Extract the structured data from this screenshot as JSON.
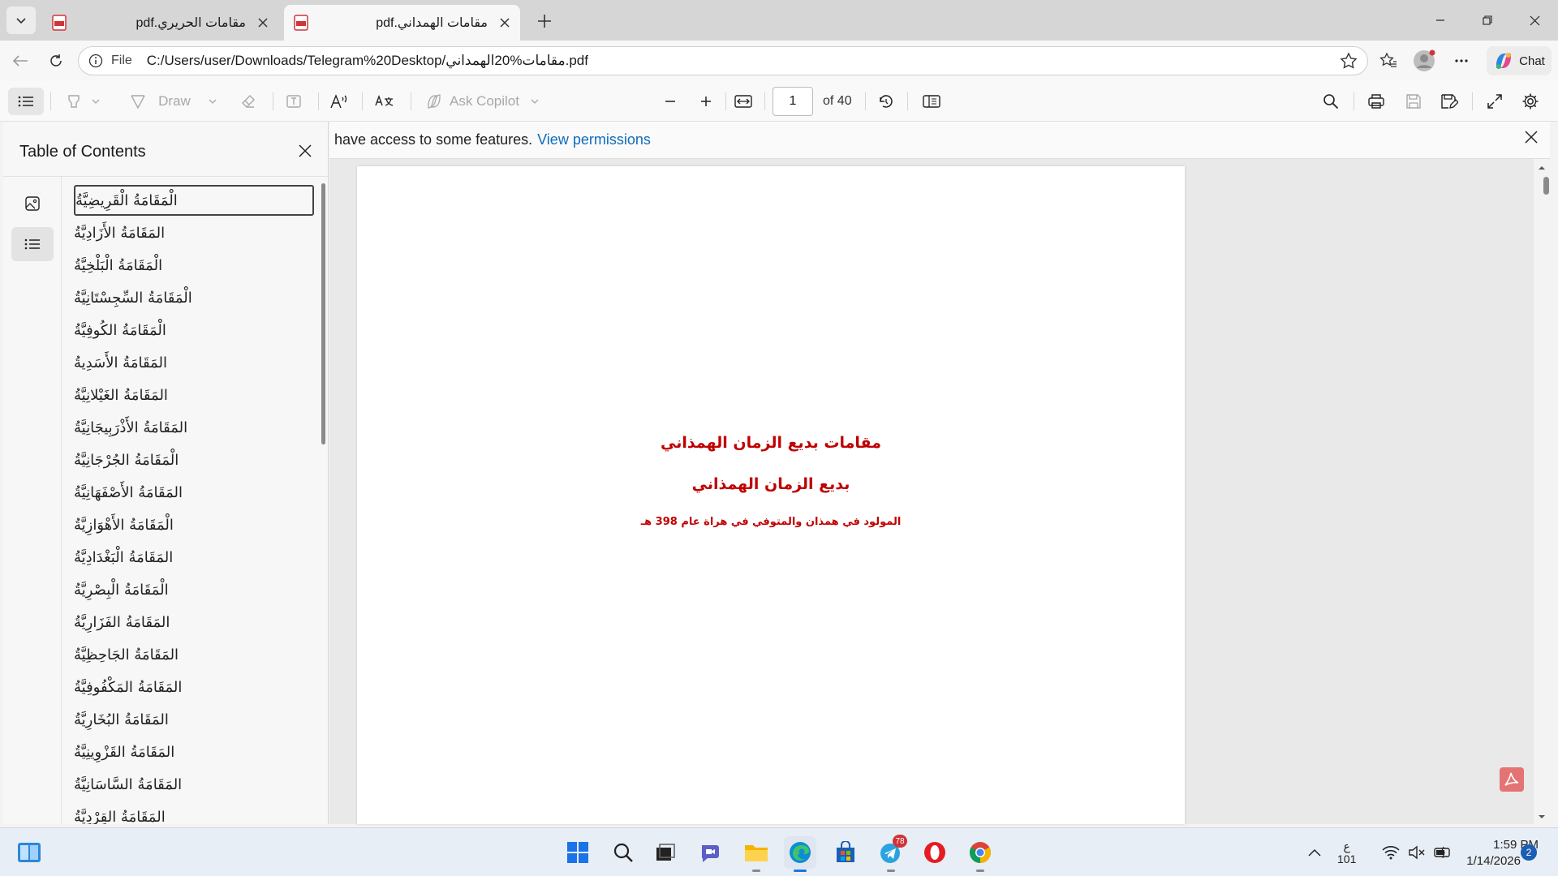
{
  "tabs": [
    {
      "title": "مقامات الحريري.pdf",
      "active": false
    },
    {
      "title": "مقامات الهمداني.pdf",
      "active": true
    }
  ],
  "address": {
    "scheme": "File",
    "url": "C:/Users/user/Downloads/Telegram%20Desktop/مقامات%20الهمداني.pdf"
  },
  "chat": {
    "label": "Chat"
  },
  "toolbar": {
    "draw_label": "Draw",
    "ask_copilot_label": "Ask Copilot",
    "page_value": "1",
    "page_count": "of 40"
  },
  "sidebar": {
    "title": "Table of Contents",
    "items": [
      "الْمَقَامَةُ الْقَرِيضِيَّةُ",
      "المَقَامَةُ الأَزَادِيَّةُ",
      "الْمَقَامَةُ الْبَلْخِيَّةُ",
      "الْمَقَامَةُ السِّجِسْتَانِيَّةُ",
      "الْمَقَامَةُ الكُوفِيَّةُ",
      "المَقَامَةُ الأَسَدِيةُ",
      "المَقَامَةُ الغَيْلانِيَّةُ",
      "المَقَامَةُ الأَذْرَبِيجَانِيَّةُ",
      "الْمَقَامَةُ الجُرْجَانِيَّةُ",
      "المَقَامَةُ الأَصْفَهَانِيَّةُ",
      "الْمَقَامَةُ الأَهْوَازِيَّةُ",
      "المَقَامَةُ الْبَغْدَادِيَّةُ",
      "الْمَقَامَةُ الْبِصْرِيَّةُ",
      "المَقَامَةُ الفَزَارِيَّةُ",
      "المَقَامَةُ الجَاحِظِيَّةُ",
      "المَقَامَةُ المَكْفُوفِيَّةُ",
      "المَقَامَةُ البُخَارِيَّةُ",
      "المَقَامَةُ القَزْوِينِيَّةُ",
      "المَقَامَةُ السَّاسَانِيَّةُ",
      "المَقَامَةُ القِرْدِيَّةُ"
    ]
  },
  "infobar": {
    "text": "have access to some features.",
    "link": "View permissions"
  },
  "document": {
    "title": "مقامات بديع الزمان الهمذاني",
    "author": "بديع الزمان الهمذاني",
    "note": "المولود في همذان والمتوفي في هراة عام 398 هـ"
  },
  "taskbar": {
    "telegram_badge": "78",
    "lang_top": "ع",
    "lang_bottom": "101",
    "time": "1:59 PM",
    "date": "1/14/2026",
    "notifications": "2"
  },
  "colors": {
    "doc_text": "#c00000",
    "link": "#0f6cbd",
    "pdf_red": "#d13438"
  }
}
